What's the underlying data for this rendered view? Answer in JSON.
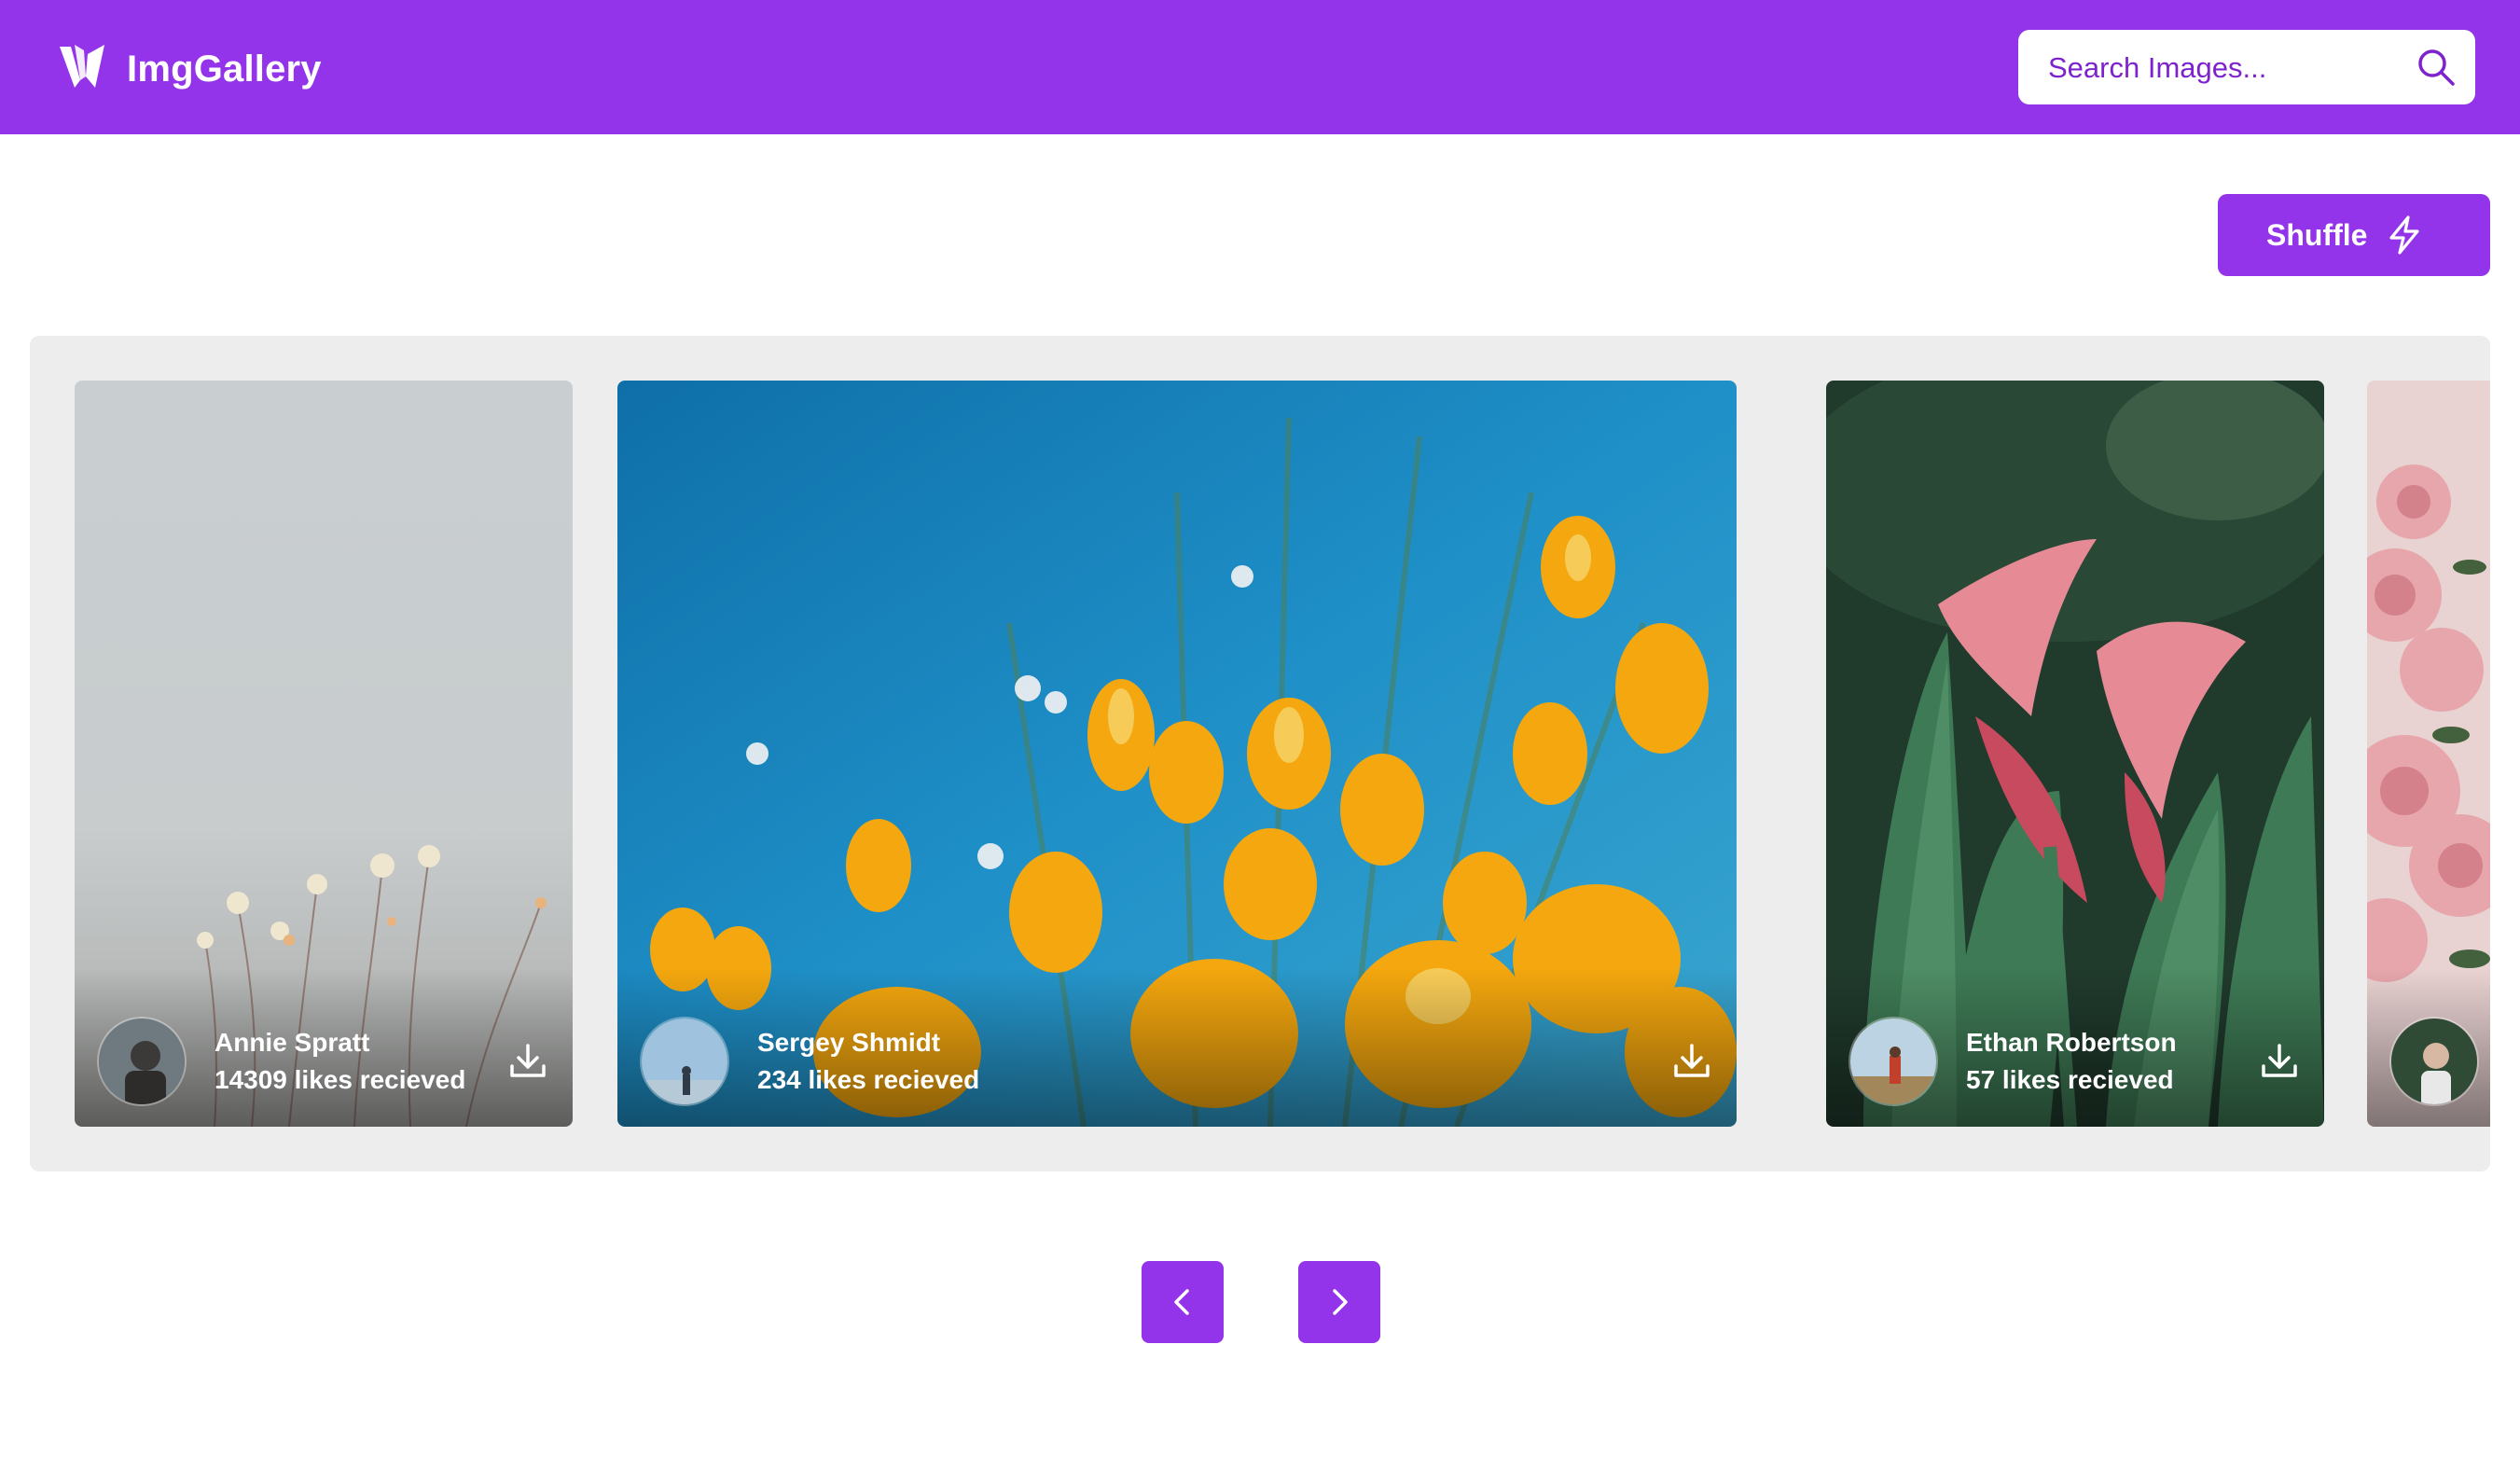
{
  "header": {
    "brand": "ImgGallery",
    "logo_icon": "stylized-w-logo-icon",
    "search_placeholder": "Search Images...",
    "search_icon": "search-icon",
    "background_color": "#9333ea"
  },
  "toolbar": {
    "shuffle_label": "Shuffle",
    "shuffle_icon": "lightning-bolt-icon"
  },
  "gallery": {
    "cards": [
      {
        "author": "Annie Spratt",
        "likes": "14309 likes recieved",
        "subject": "pale wildflowers against grey sky"
      },
      {
        "author": "Sergey Shmidt",
        "likes": "234 likes recieved",
        "subject": "yellow poppies under blue sky"
      },
      {
        "author": "Ethan Robertson",
        "likes": "57 likes recieved",
        "subject": "pink calla lilies"
      },
      {
        "author": "",
        "likes": "",
        "subject": "pink roses (partially visible)"
      }
    ],
    "download_icon": "download-icon"
  },
  "pager": {
    "prev_icon": "chevron-left-icon",
    "next_icon": "chevron-right-icon"
  },
  "colors": {
    "accent": "#9333ea",
    "gallery_background": "#ededed",
    "text_on_accent": "#ffffff"
  }
}
